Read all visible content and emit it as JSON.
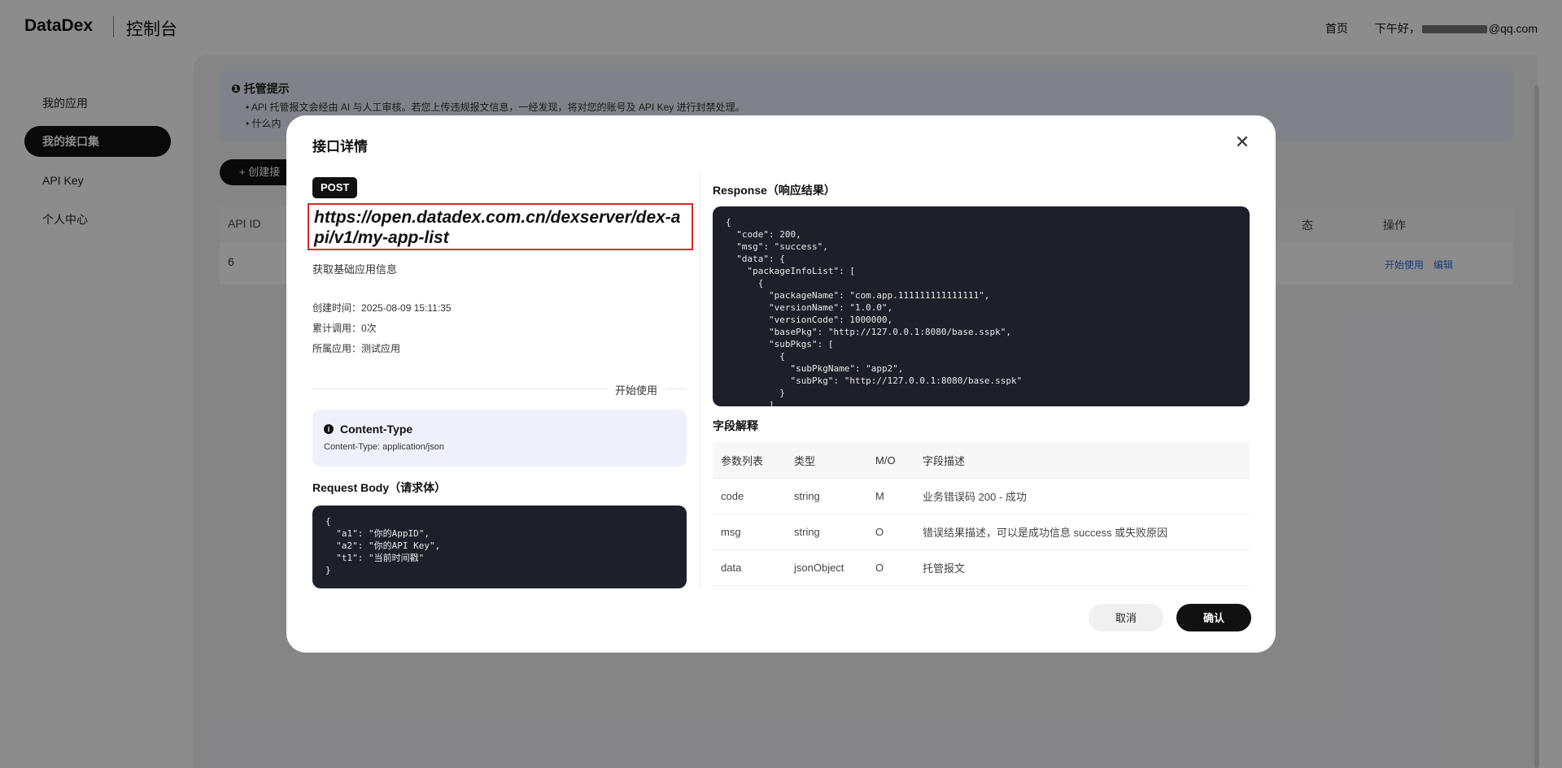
{
  "header": {
    "brand": "DataDex",
    "console": "控制台",
    "home": "首页",
    "greeting_prefix": "下午好，",
    "email_suffix": "@qq.com"
  },
  "sidebar": {
    "items": [
      {
        "label": "我的应用"
      },
      {
        "label": "我的接口集"
      },
      {
        "label": "API Key"
      },
      {
        "label": "个人中心"
      }
    ]
  },
  "notice": {
    "title": "托管提示",
    "lines": [
      "API 托管报文会经由 AI 与人工审核。若您上传违规报文信息，一经发现，将对您的账号及 API Key 进行封禁处理。",
      "什么内"
    ]
  },
  "main": {
    "create_button": "创建接",
    "table": {
      "headers": [
        "API ID",
        "态",
        "操作"
      ],
      "row": {
        "id": "6",
        "actions": [
          "开始使用",
          "编辑"
        ]
      }
    }
  },
  "modal": {
    "title": "接口详情",
    "method": "POST",
    "url": "https://open.datadex.com.cn/dexserver/dex-api/v1/my-app-list",
    "description": "获取基础应用信息",
    "meta": [
      {
        "label": "创建时间：",
        "value": "2025-08-09 15:11:35"
      },
      {
        "label": "累计调用：",
        "value": "0次"
      },
      {
        "label": "所属应用：",
        "value": "测试应用"
      }
    ],
    "start_label": "开始使用",
    "content_type": {
      "title": "Content-Type",
      "value": "Content-Type: application/json"
    },
    "request_body_title": "Request Body（请求体）",
    "request_body": "{\n  \"a1\": \"你的AppID\",\n  \"a2\": \"你的API Key\",\n  \"t1\": \"当前时间戳\"\n}",
    "response_title": "Response（响应结果）",
    "response_body": "{\n  \"code\": 200,\n  \"msg\": \"success\",\n  \"data\": {\n    \"packageInfoList\": [\n      {\n        \"packageName\": \"com.app.111111111111111\",\n        \"versionName\": \"1.0.0\",\n        \"versionCode\": 1000000,\n        \"basePkg\": \"http://127.0.0.1:8080/base.sspk\",\n        \"subPkgs\": [\n          {\n            \"subPkgName\": \"app2\",\n            \"subPkg\": \"http://127.0.0.1:8080/base.sspk\"\n          }\n        ]",
    "fields_title": "字段解释",
    "fields_headers": [
      "参数列表",
      "类型",
      "M/O",
      "字段描述"
    ],
    "fields_rows": [
      [
        "code",
        "string",
        "M",
        "业务错误码 200 - 成功"
      ],
      [
        "msg",
        "string",
        "O",
        "错误结果描述，可以是成功信息 success 或失败原因"
      ],
      [
        "data",
        "jsonObject",
        "O",
        "托管报文"
      ]
    ],
    "cancel_label": "取消",
    "confirm_label": "确认"
  }
}
